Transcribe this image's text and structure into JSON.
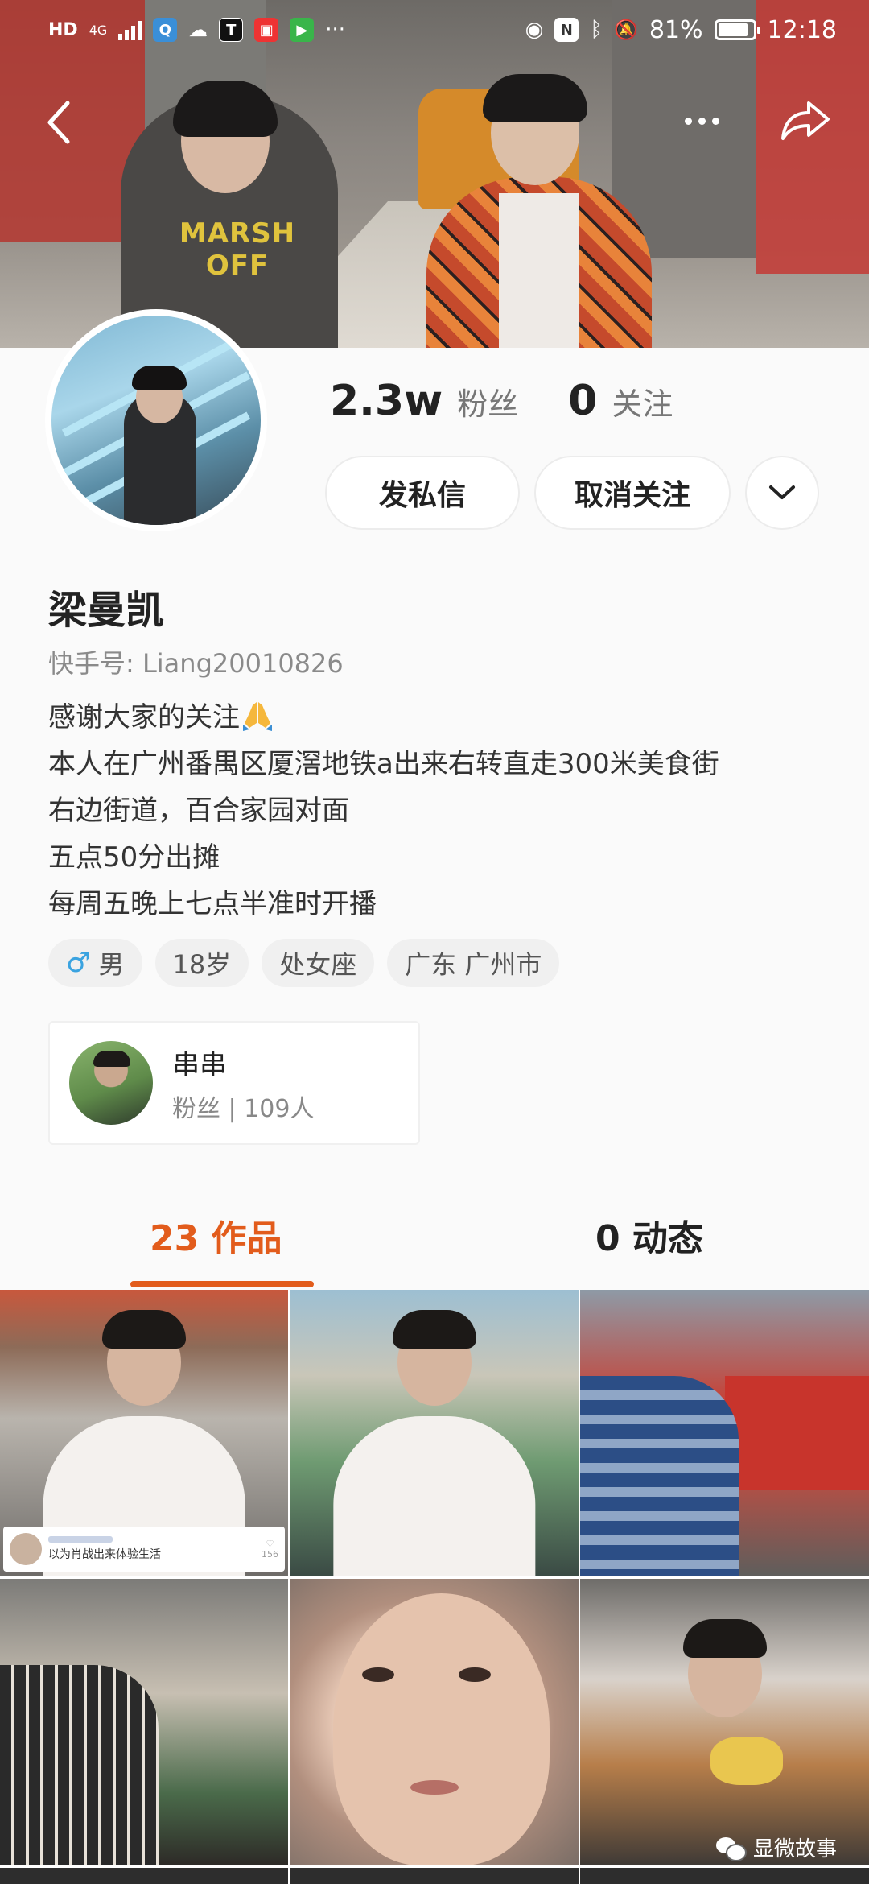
{
  "status_bar": {
    "network_hd": "HD",
    "network_gen": "4G",
    "icons": [
      "qq-icon",
      "weather-icon",
      "app-icon",
      "book-icon",
      "iqiyi-icon",
      "more-dots-icon"
    ],
    "battery_pct": "81%",
    "time": "12:18"
  },
  "header": {
    "back_icon": "chevron-left-icon",
    "more_icon": "more-icon",
    "share_icon": "share-icon",
    "banner_shirt_text": "MARSH OFF"
  },
  "profile": {
    "fans_count": "2.3w",
    "fans_label": "粉丝",
    "following_count": "0",
    "following_label": "关注",
    "message_button": "发私信",
    "unfollow_button": "取消关注",
    "name": "梁曼凯",
    "kuaishou_id": "快手号: Liang20010826",
    "bio": [
      "感谢大家的关注",
      "本人在广州番禺区厦滘地铁a出来右转直走300米美食街",
      "右边街道，百合家园对面",
      "五点50分出摊",
      "每周五晚上七点半准时开播"
    ],
    "tags": {
      "gender": "男",
      "age": "18岁",
      "zodiac": "处女座",
      "location": "广东 广州市"
    }
  },
  "friend_card": {
    "name": "串串",
    "sub": "粉丝 | 109人"
  },
  "tabs": {
    "works": "23 作品",
    "dynamics": "0 动态"
  },
  "grid_overlay": {
    "caption": "以为肖战出来体验生活",
    "likes": "156"
  },
  "watermark": "显微故事",
  "colors": {
    "accent": "#e25c1c",
    "gender_blue": "#3aa3e0"
  }
}
